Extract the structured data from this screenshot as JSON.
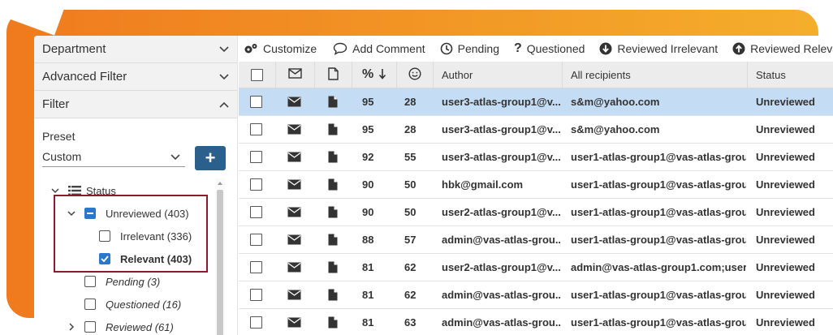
{
  "left_panel": {
    "department": "Department",
    "advanced_filter": "Advanced Filter",
    "filter": "Filter",
    "preset_label": "Preset",
    "preset_value": "Custom",
    "add_button": "+",
    "tree": {
      "status": "Status",
      "unreviewed": "Unreviewed (403)",
      "irrelevant": "Irrelevant (336)",
      "relevant": "Relevant (403)",
      "pending": "Pending (3)",
      "questioned": "Questioned (16)",
      "reviewed": "Reviewed (61)"
    }
  },
  "toolbar": {
    "customize": "Customize",
    "add_comment": "Add Comment",
    "pending": "Pending",
    "questioned": "Questioned",
    "reviewed_irrelevant": "Reviewed Irrelevant",
    "reviewed_relevant": "Reviewed Relevant"
  },
  "grid": {
    "headers": {
      "score": "%",
      "author": "Author",
      "recipients": "All recipients",
      "status": "Status"
    },
    "rows": [
      {
        "score": "95",
        "count": "28",
        "author": "user3-atlas-group1@v...",
        "recipients": "s&m@yahoo.com",
        "status": "Unreviewed",
        "selected": true
      },
      {
        "score": "95",
        "count": "28",
        "author": "user3-atlas-group1@v...",
        "recipients": "s&m@yahoo.com",
        "status": "Unreviewed",
        "selected": false
      },
      {
        "score": "92",
        "count": "55",
        "author": "user3-atlas-group1@v...",
        "recipients": "user1-atlas-group1@vas-atlas-grou...",
        "status": "Unreviewed",
        "selected": false
      },
      {
        "score": "90",
        "count": "50",
        "author": "hbk@gmail.com",
        "recipients": "user1-atlas-group1@vas-atlas-grou...",
        "status": "Unreviewed",
        "selected": false
      },
      {
        "score": "90",
        "count": "50",
        "author": "user2-atlas-group1@v...",
        "recipients": "user1-atlas-group1@vas-atlas-grou...",
        "status": "Unreviewed",
        "selected": false
      },
      {
        "score": "88",
        "count": "57",
        "author": "admin@vas-atlas-grou...",
        "recipients": "user1-atlas-group1@vas-atlas-grou...",
        "status": "Unreviewed",
        "selected": false
      },
      {
        "score": "81",
        "count": "62",
        "author": "user2-atlas-group1@v...",
        "recipients": "admin@vas-atlas-group1.com;user...",
        "status": "Unreviewed",
        "selected": false
      },
      {
        "score": "81",
        "count": "62",
        "author": "admin@vas-atlas-grou...",
        "recipients": "user1-atlas-group1@vas-atlas-grou...",
        "status": "Unreviewed",
        "selected": false
      },
      {
        "score": "81",
        "count": "63",
        "author": "admin@vas-atlas-grou...",
        "recipients": "user1-atlas-group1@vas-atlas-grou...",
        "status": "Unreviewed",
        "selected": false
      }
    ]
  },
  "colors": {
    "accent_blue": "#2b5f8c",
    "checkbox_blue": "#2b77c9",
    "selected_row": "#c4ddf4",
    "highlight_border": "#8b1c2c",
    "backdrop_orange": "#f07a1e"
  }
}
